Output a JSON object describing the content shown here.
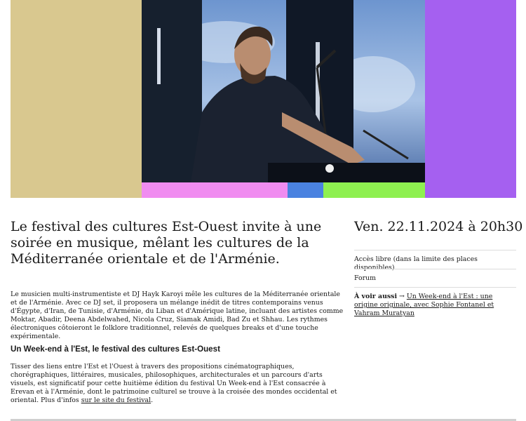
{
  "colors": {
    "sand": "#d9c88f",
    "violet": "#a560f0",
    "pink": "#f08cf0",
    "blue": "#4a82e0",
    "green": "#8ef050"
  },
  "hero": {
    "image": "photo-dj-performer"
  },
  "intro": {
    "lead": "Le festival des cultures Est-Ouest invite à une soirée en musique, mêlant les cultures de la Méditerranée orientale et de l'Arménie.",
    "body": "Le musicien multi-instrumentiste et DJ Hayk Karoyi mêle les cultures de la Méditerranée orientale et de l'Arménie. Avec ce DJ set, il proposera un mélange inédit de titres contemporains venus d'Égypte, d'Iran, de Tunisie, d'Arménie, du Liban et d'Amérique latine, incluant des artistes comme Moktar, Abadir, Deena Abdelwahed, Nicola Cruz, Siamak Amidi, Bad Zu et Shhau. Les rythmes électroniques côtoieront le folklore traditionnel, relevés de quelques breaks et d'une touche expérimentale."
  },
  "festival": {
    "heading": "Un Week-end à l'Est, le festival des cultures Est-Ouest",
    "body": "Tisser des liens entre l'Est et l'Ouest à travers des propositions cinématographiques, chorégraphiques, littéraires, musicales, philosophiques, architecturales et un parcours d'arts visuels, est significatif pour cette huitième édition du festival Un Week-end à l'Est consacrée à Erevan et à l'Arménie, dont le patrimoine culturel se trouve à la croisée des mondes occidental et oriental. Plus d'infos",
    "link": "sur le site du festival",
    "end": "."
  },
  "event": {
    "date": "Ven. 22.11.2024 à 20h30",
    "access": "Accès libre (dans la limite des places disponibles)",
    "venue": "Forum",
    "see_also_label": "À voir aussi",
    "arrow": " → ",
    "see_also_link": "Un Week-end à l'Est : une origine originale, avec Sophie Fontanel et Vahram Muratyan"
  }
}
